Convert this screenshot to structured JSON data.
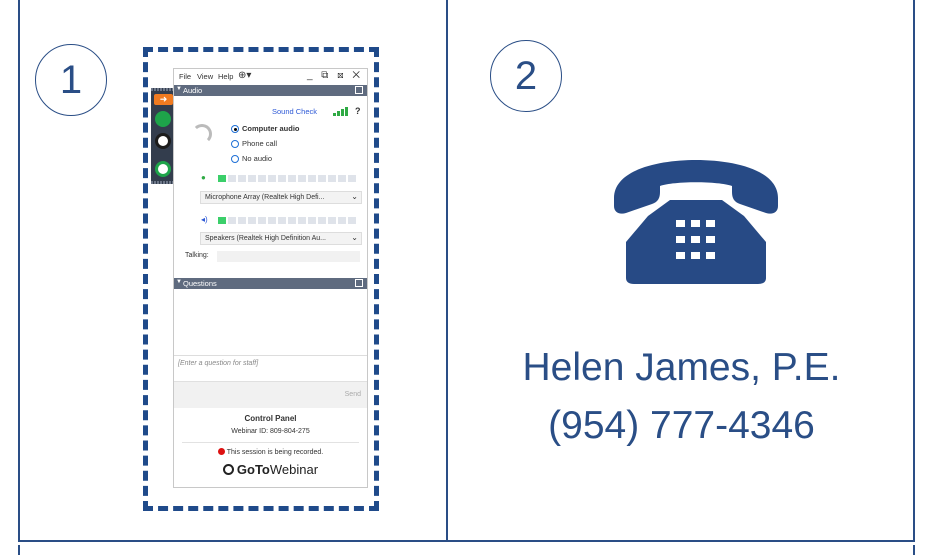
{
  "panels": [
    {
      "number": "1"
    },
    {
      "number": "2"
    }
  ],
  "control_panel": {
    "menu": [
      "File",
      "View",
      "Help"
    ],
    "window_controls": "_ ⧉ ⊠ ✕",
    "audio_header": "Audio",
    "sound_check": "Sound Check",
    "help_mark": "?",
    "audio_options": [
      {
        "label": "Computer audio",
        "selected": true
      },
      {
        "label": "Phone call",
        "selected": false
      },
      {
        "label": "No audio",
        "selected": false
      }
    ],
    "microphone": "Microphone Array (Realtek High Defi...",
    "speakers": "Speakers (Realtek High Definition Au...",
    "talking_label": "Talking:",
    "questions_header": "Questions",
    "question_placeholder": "[Enter a question for staff]",
    "send_label": "Send",
    "title": "Control Panel",
    "webinar_id": "Webinar ID: 809-804-275",
    "recording_notice": "This session is being recorded.",
    "brand_bold": "GoTo",
    "brand_rest": "Webinar"
  },
  "contact": {
    "name": "Helen James, P.E.",
    "phone": "(954) 777-4346"
  },
  "colors": {
    "primary": "#2a4e86",
    "phone_icon": "#274a85",
    "record": "#dd1111",
    "meter_on": "#3bcf6a"
  },
  "icons": [
    "phone-icon",
    "headset-icon",
    "microphone-icon",
    "speaker-icon",
    "globe-icon"
  ]
}
